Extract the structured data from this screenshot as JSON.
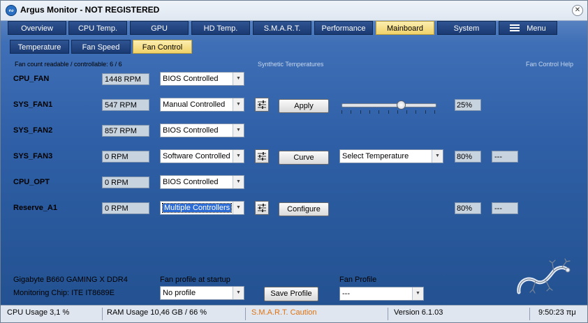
{
  "window": {
    "title": "Argus Monitor - NOT REGISTERED",
    "app_icon_glyph": "∾",
    "close_glyph": "✕"
  },
  "main_tabs": [
    {
      "label": "Overview"
    },
    {
      "label": "CPU Temp."
    },
    {
      "label": "GPU"
    },
    {
      "label": "HD Temp."
    },
    {
      "label": "S.M.A.R.T."
    },
    {
      "label": "Performance"
    },
    {
      "label": "Mainboard"
    },
    {
      "label": "System"
    },
    {
      "label": "Menu"
    }
  ],
  "sub_tabs": [
    {
      "label": "Temperature"
    },
    {
      "label": "Fan Speed"
    },
    {
      "label": "Fan Control"
    }
  ],
  "hints": {
    "fan_count": "Fan count readable / controllable: 6 / 6",
    "synthetic": "Synthetic Temperatures",
    "help": "Fan Control Help"
  },
  "fans": [
    {
      "name": "CPU_FAN",
      "rpm": "1448 RPM",
      "mode": "BIOS Controlled"
    },
    {
      "name": "SYS_FAN1",
      "rpm": "547 RPM",
      "mode": "Manual Controlled",
      "button": "Apply",
      "value": "25%"
    },
    {
      "name": "SYS_FAN2",
      "rpm": "857 RPM",
      "mode": "BIOS Controlled"
    },
    {
      "name": "SYS_FAN3",
      "rpm": "0 RPM",
      "mode": "Software Controlled",
      "button": "Curve",
      "temp_select": "Select Temperature",
      "value": "80%",
      "extra": "---"
    },
    {
      "name": "CPU_OPT",
      "rpm": "0 RPM",
      "mode": "BIOS Controlled"
    },
    {
      "name": "Reserve_A1",
      "rpm": "0 RPM",
      "mode": "Multiple Controllers",
      "button": "Configure",
      "value": "80%",
      "extra": "---"
    }
  ],
  "slider": {
    "level_percent": 25
  },
  "footer": {
    "board": "Gigabyte B660 GAMING X DDR4",
    "chip": "Monitoring Chip: ITE IT8689E",
    "startup_label": "Fan profile at startup",
    "startup_value": "No profile",
    "save_button": "Save Profile",
    "profile_label": "Fan Profile",
    "profile_value": "---"
  },
  "status": {
    "cpu": "CPU Usage 3,1 %",
    "ram": "RAM Usage 10,46 GB / 66 %",
    "smart": "S.M.A.R.T. Caution",
    "version": "Version 6.1.03",
    "time": "9:50:23 πμ"
  },
  "colors": {
    "smart_caution": "#e0720f",
    "synthetic_hint": "#c8d8ee",
    "help_hint": "#c8d8ee",
    "active_tab": "#f1d269"
  },
  "icons": {
    "menu_icon": "hamburger",
    "fan_settings_icon": "sliders",
    "logo": "gecko-logo"
  }
}
